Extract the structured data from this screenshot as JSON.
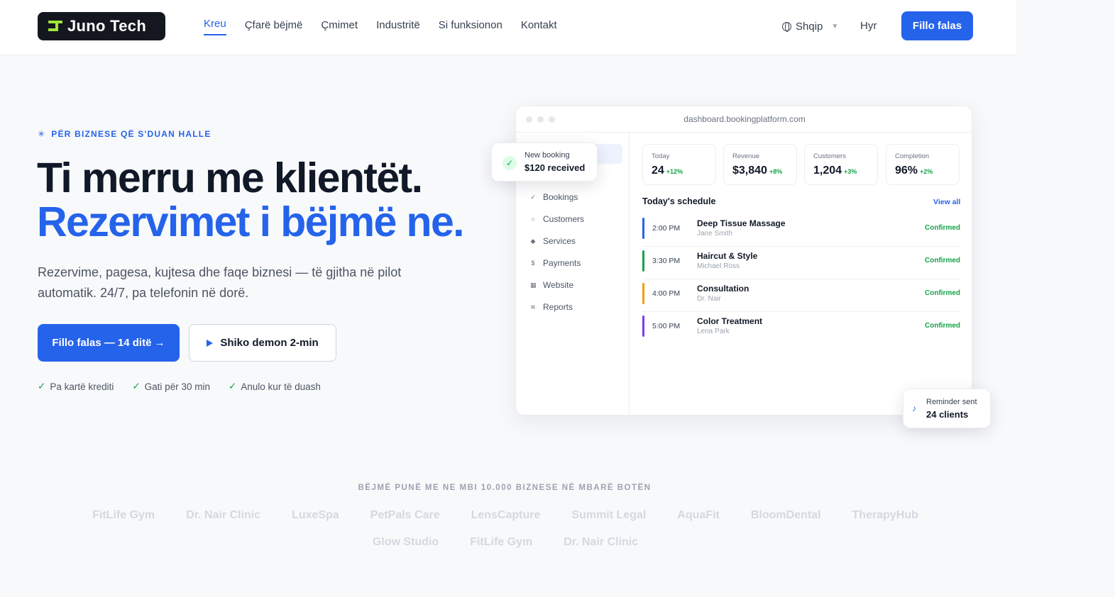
{
  "nav": {
    "logo_text": "Juno Tech",
    "links": [
      "Kreu",
      "Çfarë bëjmë",
      "Çmimet",
      "Industritë",
      "Si funksionon",
      "Kontakt"
    ],
    "language": "Shqip",
    "login": "Hyr",
    "cta": "Fillo falas"
  },
  "hero": {
    "eyebrow": "PËR BIZNESE QË S'DUAN HALLE",
    "title_line1": "Ti merru me klientët.",
    "title_line2": "Rezervimet i bëjmë ne.",
    "subtitle": "Rezervime, pagesa, kujtesa dhe faqe biznesi — të gjitha në pilot automatik. 24/7, pa telefonin në dorë.",
    "primary_cta": "Fillo falas — 14 ditë →",
    "secondary_cta": "Shiko demon 2-min",
    "perks": [
      "Pa kartë krediti",
      "Gati për 30 min",
      "Anulo kur të duash"
    ]
  },
  "dashboard": {
    "url": "dashboard.bookingplatform.com",
    "sidebar": [
      "Bookings",
      "Customers",
      "Services",
      "Payments",
      "Website",
      "Reports"
    ],
    "sidebar_icons": [
      "✓",
      "○",
      "◆",
      "$",
      "▦",
      "≋"
    ],
    "stats": [
      {
        "label": "Today",
        "value": "24",
        "delta": "+12%"
      },
      {
        "label": "Revenue",
        "value": "$3,840",
        "delta": "+8%"
      },
      {
        "label": "Customers",
        "value": "1,204",
        "delta": "+3%"
      },
      {
        "label": "Completion",
        "value": "96%",
        "delta": "+2%"
      }
    ],
    "schedule_title": "Today's schedule",
    "view_all": "View all",
    "schedule": [
      {
        "time": "2:00 PM",
        "service": "Deep Tissue Massage",
        "client": "Jane Smith",
        "status": "Confirmed",
        "color": "#2563eb"
      },
      {
        "time": "3:30 PM",
        "service": "Haircut & Style",
        "client": "Michael Ross",
        "status": "Confirmed",
        "color": "#16a34a"
      },
      {
        "time": "4:00 PM",
        "service": "Consultation",
        "client": "Dr. Nair",
        "status": "Confirmed",
        "color": "#f59e0b"
      },
      {
        "time": "5:00 PM",
        "service": "Color Treatment",
        "client": "Lena Park",
        "status": "Confirmed",
        "color": "#7c3aed"
      }
    ],
    "toast_booking": {
      "label": "New booking",
      "value": "$120 received"
    },
    "toast_reminder": {
      "label": "Reminder sent",
      "value": "24 clients"
    }
  },
  "trust": {
    "headline": "BËJMË PUNË ME NE MBI 10.000 BIZNESE NË MBARË BOTËN",
    "logos": [
      "FitLife Gym",
      "Dr. Nair Clinic",
      "LuxeSpa",
      "PetPals Care",
      "LensCapture",
      "Summit Legal",
      "AquaFit",
      "BloomDental",
      "TherapyHub",
      "Glow Studio",
      "FitLife Gym",
      "Dr. Nair Clinic"
    ]
  },
  "colors": {
    "accent": "#2563eb",
    "success": "#16a34a",
    "logo_bg": "#14171f",
    "logo_mark": "#a3e635"
  }
}
